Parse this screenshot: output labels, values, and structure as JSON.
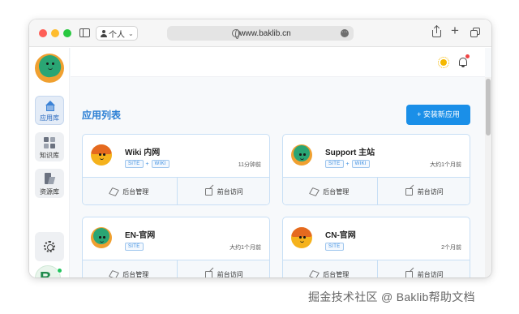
{
  "browser": {
    "profile_label": "个人",
    "url": "www.baklib.cn"
  },
  "sidebar": {
    "items": [
      {
        "label": "应用库"
      },
      {
        "label": "知识库"
      },
      {
        "label": "资源库"
      }
    ],
    "user_initial": "B."
  },
  "main": {
    "title": "应用列表",
    "install_button": "+ 安装新应用",
    "action_admin": "后台管理",
    "action_frontend": "前台访问",
    "apps": [
      {
        "name": "Wiki 内网",
        "tags": [
          "SITE",
          "WIKI"
        ],
        "time": "11分钟前"
      },
      {
        "name": "Support 主站",
        "tags": [
          "SITE",
          "WIKI"
        ],
        "time": "大约1个月前"
      },
      {
        "name": "EN-官网",
        "tags": [
          "SITE"
        ],
        "time": "大约1个月前"
      },
      {
        "name": "CN-官网",
        "tags": [
          "SITE"
        ],
        "time": "2个月前"
      }
    ]
  },
  "watermark": "掘金技术社区 @ Baklib帮助文档",
  "colors": {
    "accent": "#1a8fe8",
    "title_blue": "#2b7fd4",
    "card_border": "#c8dff5"
  },
  "icons": [
    "sidebar-toggle-icon",
    "person-icon",
    "globe-icon",
    "share-icon",
    "plus-icon",
    "tabs-icon",
    "home-icon",
    "grid-icon",
    "folder-icon",
    "gear-icon",
    "sun-icon",
    "bell-icon",
    "cube-icon",
    "external-link-icon"
  ]
}
